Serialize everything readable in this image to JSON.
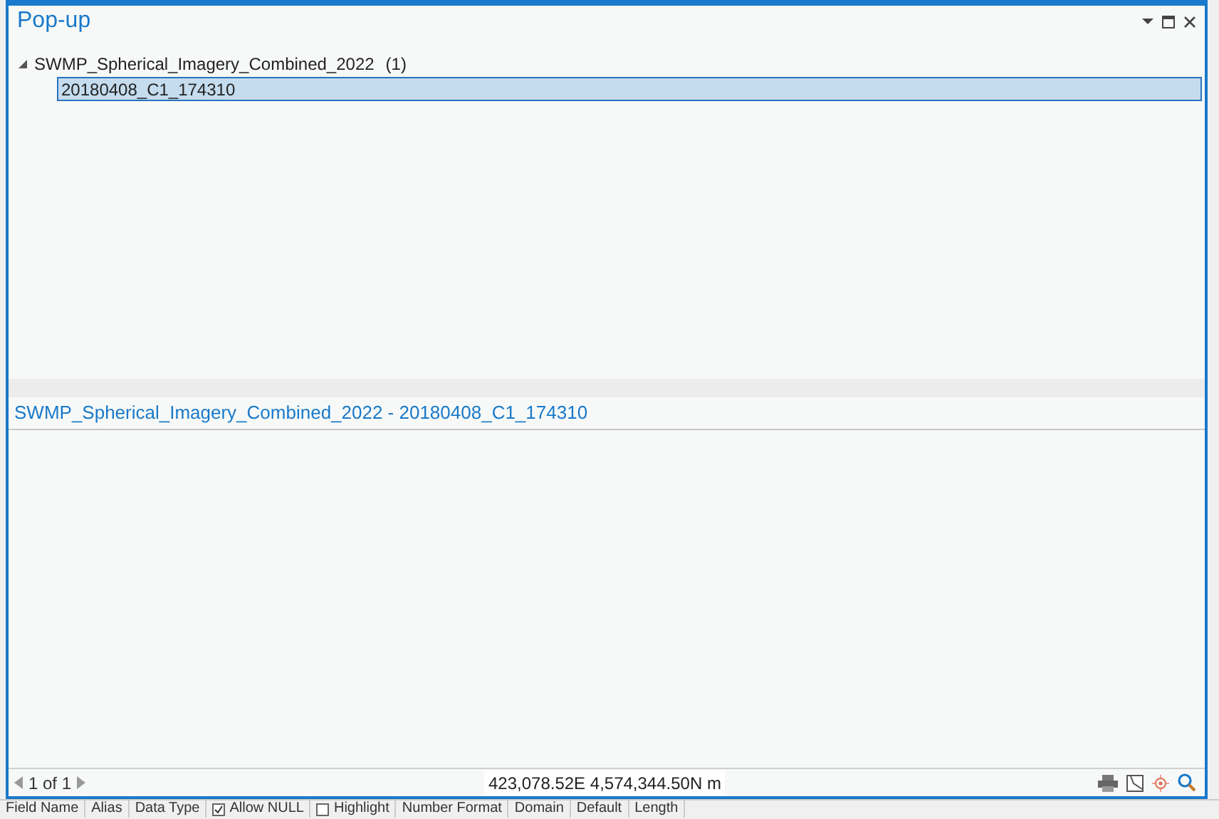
{
  "window": {
    "title": "Pop-up"
  },
  "tree": [
    {
      "label": "SWMP_Spherical_Imagery_Combined_2022",
      "count": "(1)",
      "expanded": true,
      "children": [
        {
          "label": "20180408_C1_174310",
          "selected": true
        }
      ]
    }
  ],
  "detail": {
    "title": "SWMP_Spherical_Imagery_Combined_2022 - 20180408_C1_174310"
  },
  "footer": {
    "page": "1 of 1",
    "coordinates": "423,078.52E 4,574,344.50N m"
  },
  "background_columns": [
    {
      "label": "Field Name",
      "kind": "text"
    },
    {
      "label": "Alias",
      "kind": "text"
    },
    {
      "label": "Data Type",
      "kind": "text"
    },
    {
      "label": "Allow NULL",
      "kind": "check",
      "checked": true
    },
    {
      "label": "Highlight",
      "kind": "check",
      "checked": false
    },
    {
      "label": "Number Format",
      "kind": "text"
    },
    {
      "label": "Domain",
      "kind": "text"
    },
    {
      "label": "Default",
      "kind": "text"
    },
    {
      "label": "Length",
      "kind": "text"
    }
  ]
}
